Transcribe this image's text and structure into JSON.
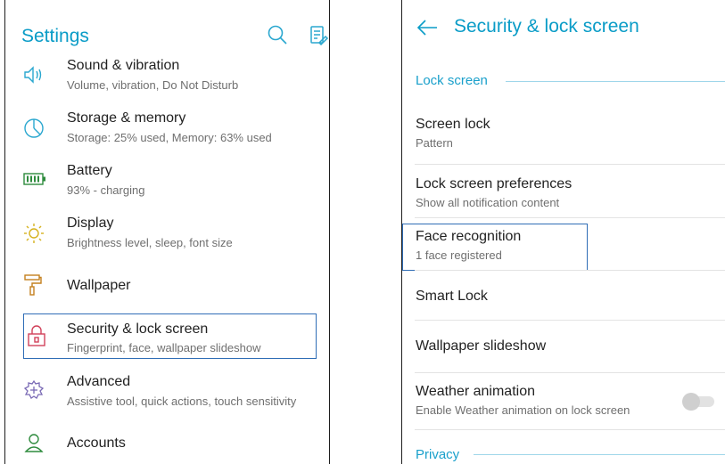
{
  "settings": {
    "title": "Settings",
    "items": [
      {
        "icon": "volume-icon",
        "title": "Sound & vibration",
        "subtitle": "Volume, vibration, Do Not Disturb"
      },
      {
        "icon": "storage-icon",
        "title": "Storage & memory",
        "subtitle": "Storage: 25% used, Memory: 63% used"
      },
      {
        "icon": "battery-icon",
        "title": "Battery",
        "subtitle": "93% - charging"
      },
      {
        "icon": "display-icon",
        "title": "Display",
        "subtitle": "Brightness level, sleep, font size"
      },
      {
        "icon": "wallpaper-roller-icon",
        "title": "Wallpaper",
        "subtitle": ""
      },
      {
        "icon": "lock-icon",
        "title": "Security & lock screen",
        "subtitle": "Fingerprint, face, wallpaper slideshow"
      },
      {
        "icon": "advanced-gear-plus-icon",
        "title": "Advanced",
        "subtitle": "Assistive tool, quick actions, touch sensitivity"
      },
      {
        "icon": "person-icon",
        "title": "Accounts",
        "subtitle": ""
      }
    ]
  },
  "security": {
    "title": "Security & lock screen",
    "section_lock": "Lock screen",
    "items": [
      {
        "title": "Screen lock",
        "subtitle": "Pattern"
      },
      {
        "title": "Lock screen preferences",
        "subtitle": "Show all notification content"
      },
      {
        "title": "Face recognition",
        "subtitle": "1 face registered"
      },
      {
        "title": "Smart Lock",
        "subtitle": ""
      },
      {
        "title": "Wallpaper slideshow",
        "subtitle": ""
      },
      {
        "title": "Weather animation",
        "subtitle": "Enable Weather animation on lock screen"
      }
    ],
    "weather_toggle_on": false,
    "section_privacy": "Privacy"
  },
  "colors": {
    "accent": "#0a9cc7",
    "highlight": "#2f6db6"
  }
}
